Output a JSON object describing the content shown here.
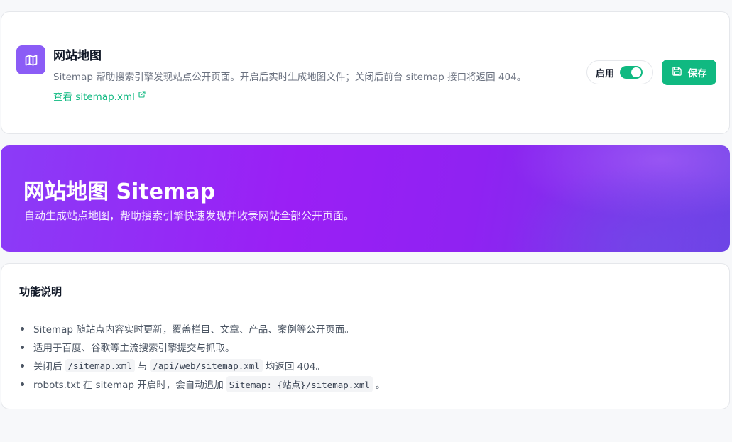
{
  "header": {
    "title": "网站地图",
    "description": "Sitemap 帮助搜索引擎发现站点公开页面。开启后实时生成地图文件；关闭后前台 sitemap 接口将返回 404。",
    "link_text": "查看 sitemap.xml",
    "toggle_label": "启用",
    "toggle_on": true,
    "save_label": "保存",
    "icon": "map-icon",
    "accent": "#8b5cf6",
    "primary": "#10b981"
  },
  "banner": {
    "title": "网站地图 Sitemap",
    "subtitle": "自动生成站点地图，帮助搜索引擎快速发现并收录网站全部公开页面。"
  },
  "info": {
    "title": "功能说明",
    "items": {
      "i1": "Sitemap 随站点内容实时更新，覆盖栏目、文章、产品、案例等公开页面。",
      "i2": "适用于百度、谷歌等主流搜索引擎提交与抓取。",
      "i3_pre": "关闭后",
      "i3_code1": "/sitemap.xml",
      "i3_mid": "与",
      "i3_code2": "/api/web/sitemap.xml",
      "i3_post": "均返回 404。",
      "i4_pre": "robots.txt 在 sitemap 开启时，会自动追加",
      "i4_code": "Sitemap: {站点}/sitemap.xml",
      "i4_post": "。"
    }
  }
}
